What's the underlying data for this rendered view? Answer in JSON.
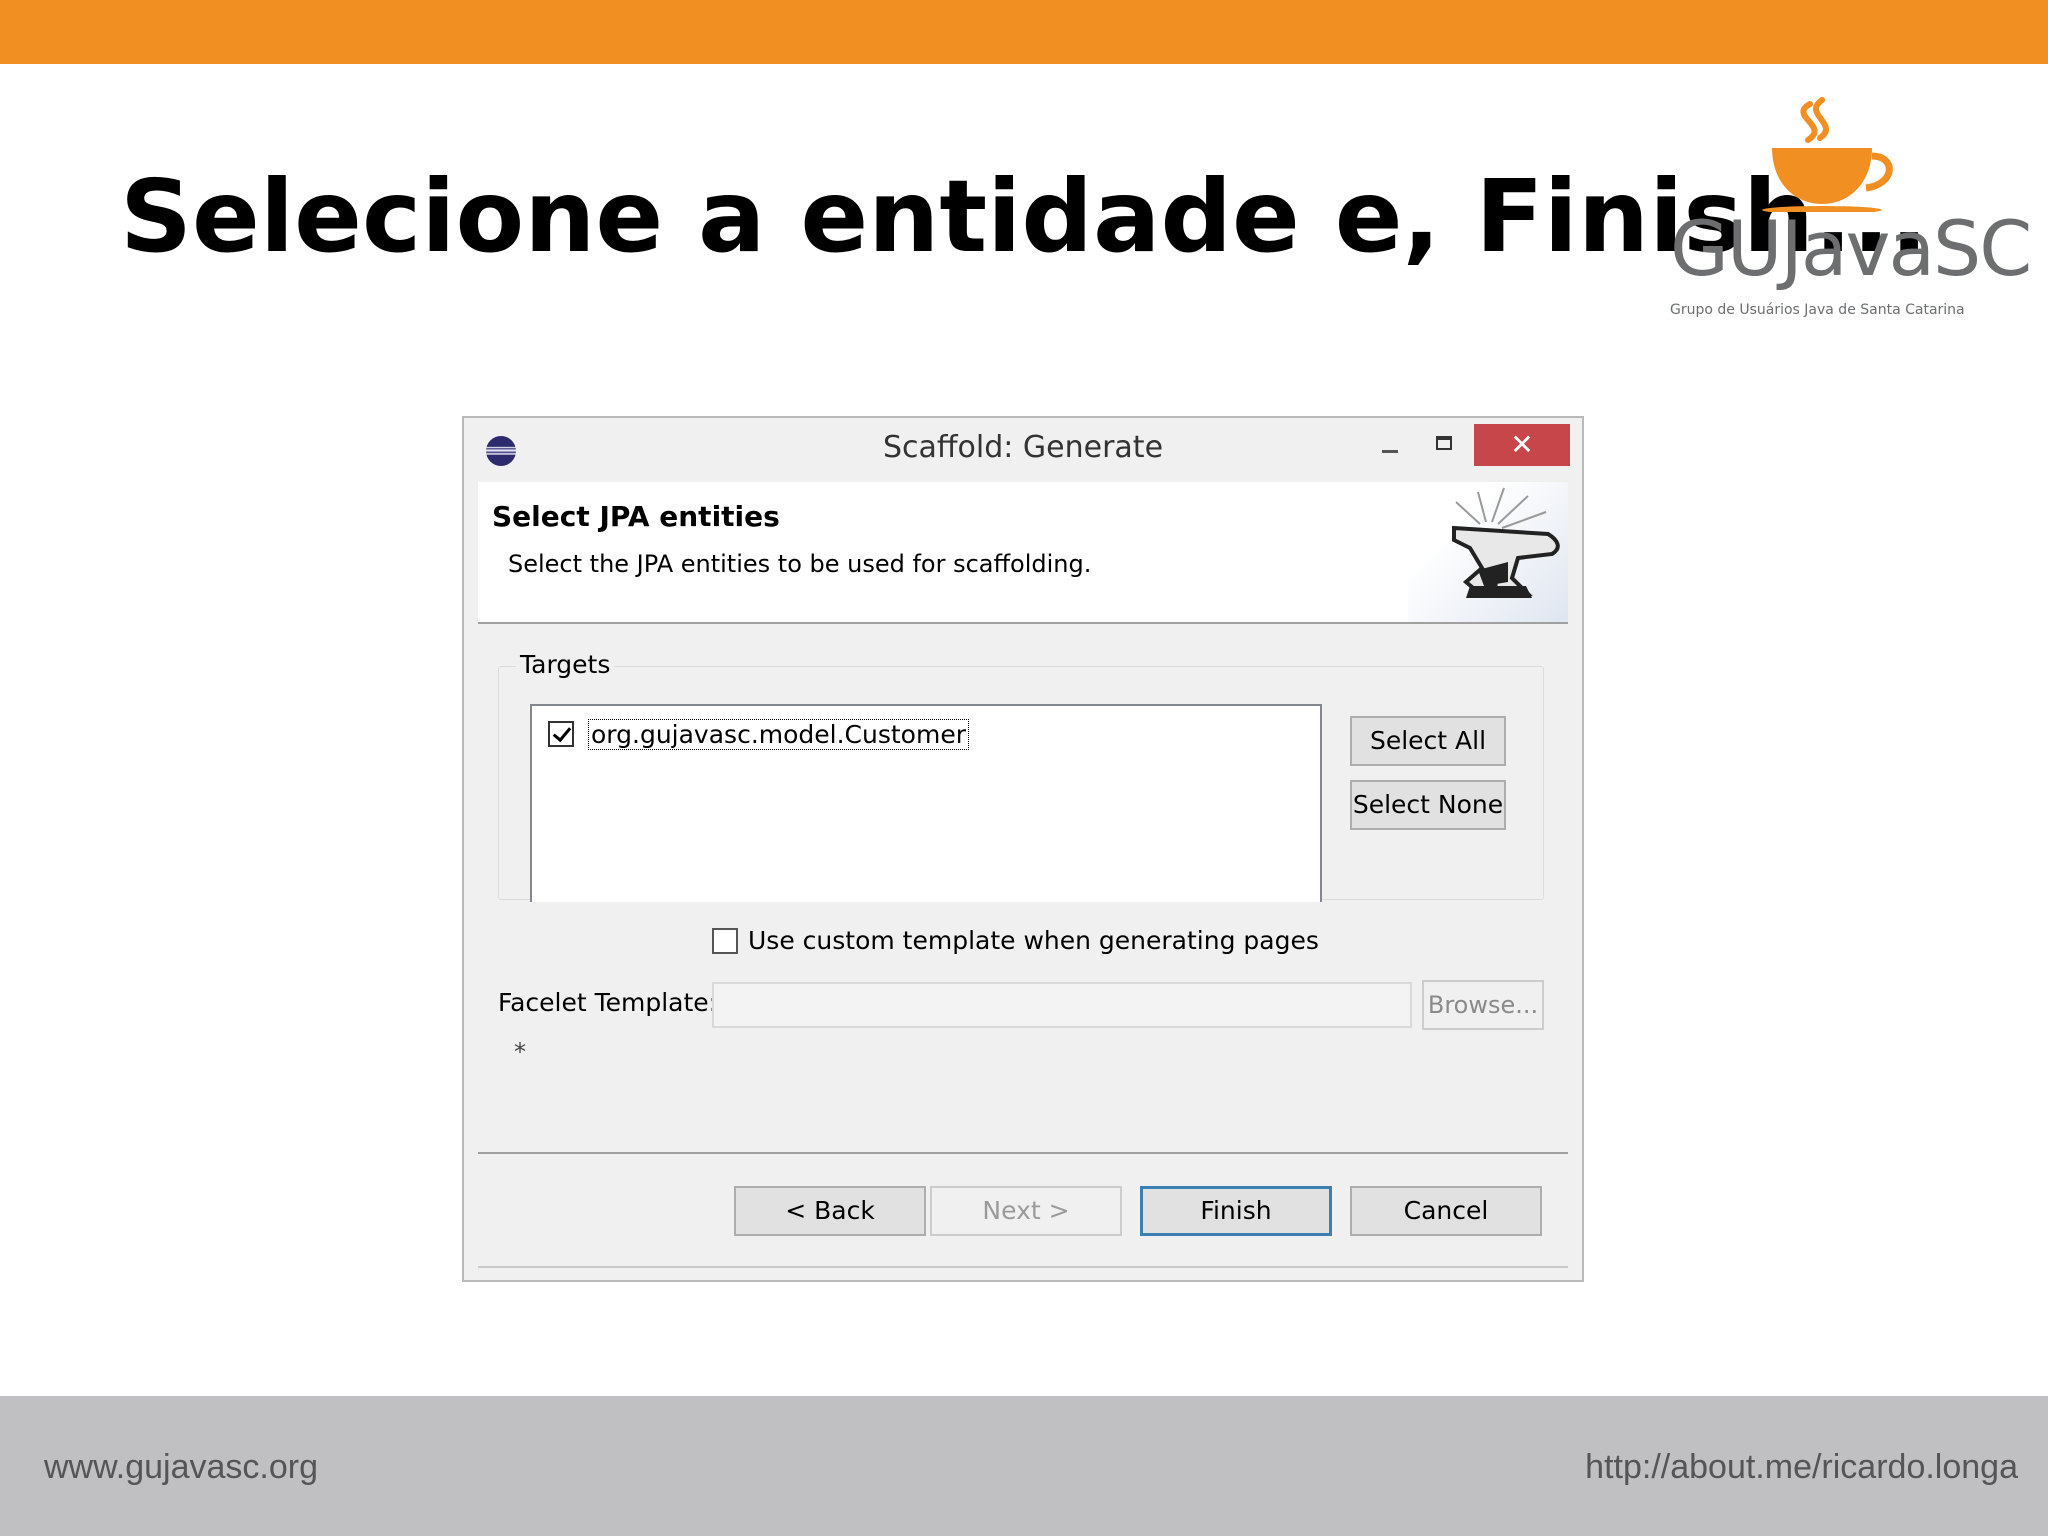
{
  "slide": {
    "title": "Selecione a entidade e, Finish...",
    "logo": {
      "name": "GUJavaSC",
      "tagline": "Grupo de Usuários Java de Santa Catarina"
    },
    "footer_left": "www.gujavasc.org",
    "footer_right": "http://about.me/ricardo.longa",
    "accent_color": "#f28f22"
  },
  "dialog": {
    "title": "Scaffold: Generate",
    "close_glyph": "✕",
    "header": {
      "title": "Select JPA entities",
      "description": "Select the JPA entities to be used for scaffolding."
    },
    "targets": {
      "label": "Targets",
      "items": [
        {
          "label": "org.gujavasc.model.Customer",
          "checked": true
        }
      ],
      "select_all": "Select All",
      "select_none": "Select None"
    },
    "custom_template": {
      "label": "Use custom template when generating pages",
      "checked": false
    },
    "facelet": {
      "label": "Facelet Template:",
      "value": "",
      "browse": "Browse..."
    },
    "asterisk": "*",
    "buttons": {
      "back": "< Back",
      "next": "Next >",
      "finish": "Finish",
      "cancel": "Cancel"
    },
    "icons": {
      "app": "eclipse-icon",
      "header": "anvil-icon"
    }
  }
}
